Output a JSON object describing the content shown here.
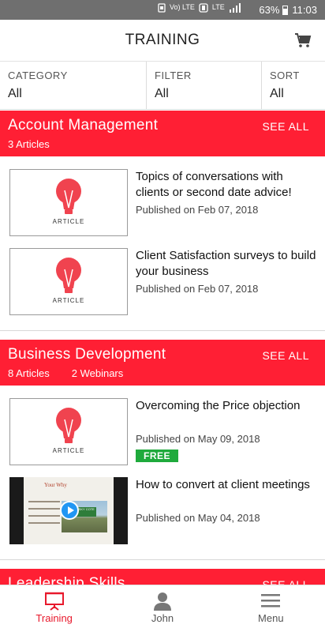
{
  "status_bar": {
    "icons": [
      "notification-icon",
      "volte-icon",
      "data-saver-icon",
      "lte-signal-icon",
      "signal-icon"
    ],
    "volte_text": "Vo) LTE",
    "lte_text": "LTE",
    "battery_percent": "63%",
    "time": "11:03"
  },
  "header": {
    "title": "TRAINING",
    "cart_icon": "cart-icon"
  },
  "filters": {
    "category_label": "CATEGORY",
    "category_value": "All",
    "filter_label": "FILTER",
    "filter_value": "All",
    "sort_label": "SORT",
    "sort_value": "All"
  },
  "sections": [
    {
      "title": "Account Management",
      "counts": [
        "3 Articles"
      ],
      "see_all": "SEE ALL",
      "items": [
        {
          "title": "Topics of conversations with clients or second date advice!",
          "date": "Published on Feb 07, 2018",
          "thumb_label": "ARTICLE"
        },
        {
          "title": "Client Satisfaction surveys to build your business",
          "date": "Published on Feb 07, 2018",
          "thumb_label": "ARTICLE"
        }
      ]
    },
    {
      "title": "Business Development",
      "counts": [
        "8 Articles",
        "2 Webinars"
      ],
      "see_all": "SEE ALL",
      "items": [
        {
          "title": "Overcoming the Price objection",
          "date": "Published on May 09, 2018",
          "thumb_label": "ARTICLE",
          "badge": "FREE"
        },
        {
          "title": "How to convert at client meetings",
          "date": "Published on May 04, 2018",
          "video_slide_title": "Your Why",
          "video_sign": "LIST SKY COTE"
        }
      ]
    },
    {
      "title": "Leadership Skills",
      "see_all": "SEE ALL"
    }
  ],
  "colors": {
    "section_red": "#ff1f34",
    "active_nav": "#e8192c",
    "free_green": "#1faa3c",
    "bulb_red": "#f0434f"
  },
  "bottom_nav": {
    "items": [
      {
        "label": "Training",
        "icon": "training-icon",
        "active": true
      },
      {
        "label": "John",
        "icon": "person-icon",
        "active": false
      },
      {
        "label": "Menu",
        "icon": "hamburger-menu-icon",
        "active": false
      }
    ]
  }
}
